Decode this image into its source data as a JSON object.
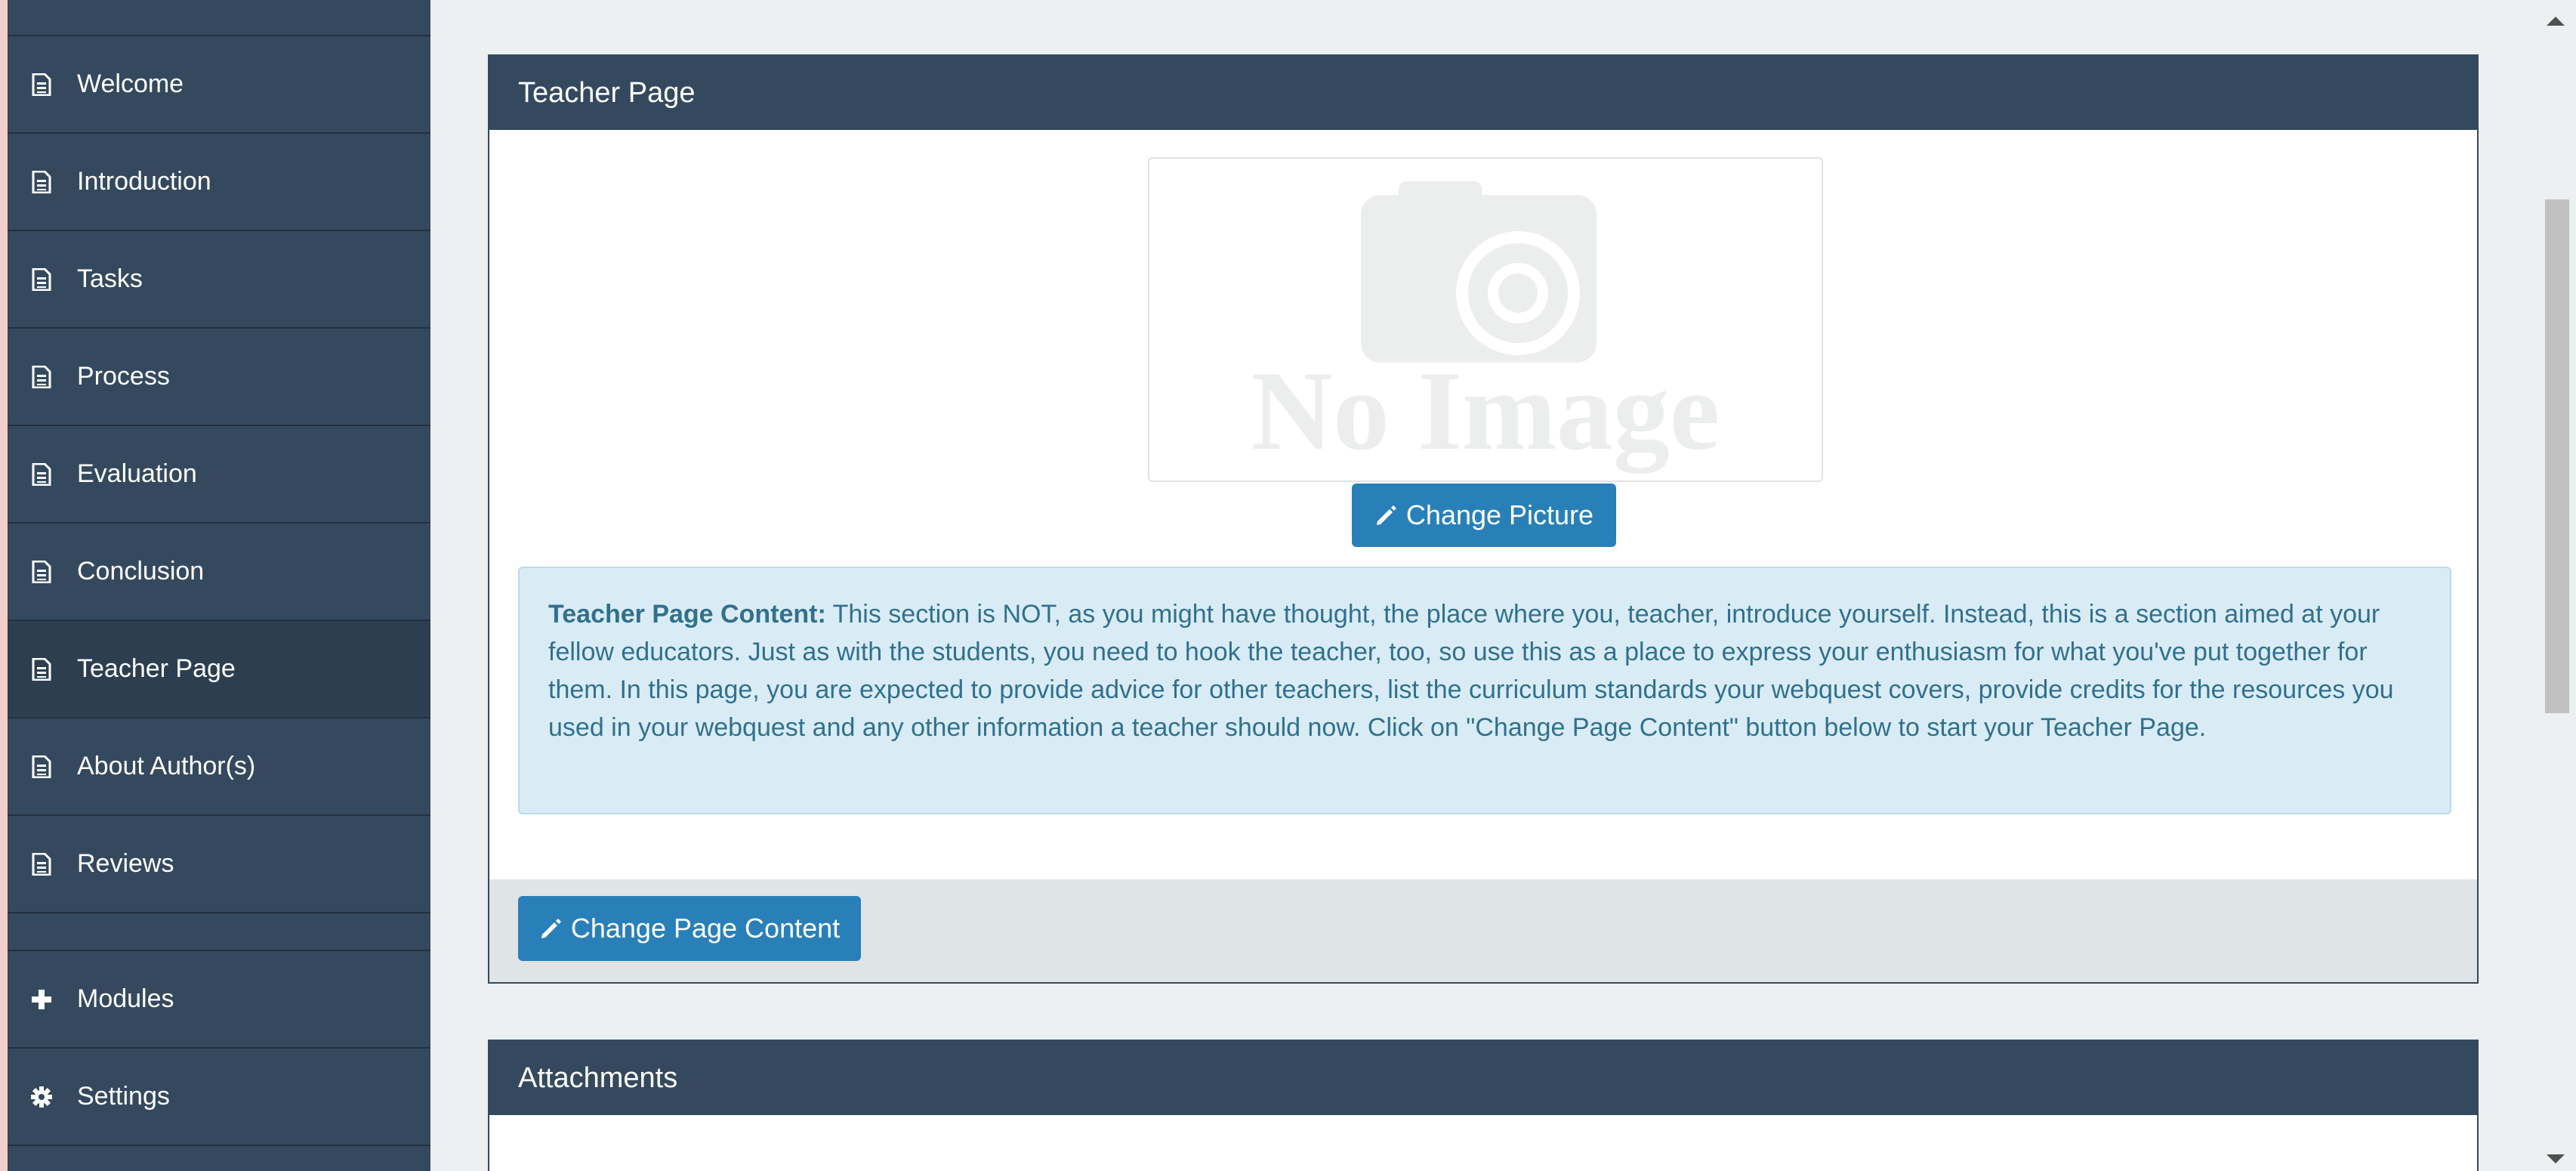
{
  "sidebar": {
    "items": [
      {
        "label": "Welcome",
        "icon": "file-text-icon"
      },
      {
        "label": "Introduction",
        "icon": "file-text-icon"
      },
      {
        "label": "Tasks",
        "icon": "file-text-icon"
      },
      {
        "label": "Process",
        "icon": "file-text-icon"
      },
      {
        "label": "Evaluation",
        "icon": "file-text-icon"
      },
      {
        "label": "Conclusion",
        "icon": "file-text-icon"
      },
      {
        "label": "Teacher Page",
        "icon": "file-text-icon",
        "active": true
      },
      {
        "label": "About Author(s)",
        "icon": "file-text-icon"
      },
      {
        "label": "Reviews",
        "icon": "file-text-icon"
      }
    ],
    "extras": [
      {
        "label": "Modules",
        "icon": "plus-icon"
      },
      {
        "label": "Settings",
        "icon": "gear-icon"
      }
    ]
  },
  "teacher_panel": {
    "title": "Teacher Page",
    "placeholder_image_text": "No Image",
    "change_picture_label": "Change Picture",
    "info_label": "Teacher Page Content:",
    "info_text": " This section is NOT, as you might have thought, the place where you, teacher, introduce yourself. Instead, this is a section aimed at your fellow educators. Just as with the students, you need to hook the teacher, too, so use this as a place to express your enthusiasm for what you've put together for them. In this page, you are expected to provide advice for other teachers, list the curriculum standards your webquest covers, provide credits for the resources you used in your webquest and any other information a teacher should now. Click on \"Change Page Content\" button below to start your Teacher Page.",
    "change_content_label": "Change Page Content"
  },
  "attachments_panel": {
    "title": "Attachments"
  },
  "colors": {
    "sidebar_bg": "#34495e",
    "sidebar_active": "#2c3e50",
    "panel_header": "#34495e",
    "primary_button": "#2980b9",
    "info_bg": "#d9ecf5",
    "info_text": "#31708f",
    "page_bg": "#ecf0f1"
  }
}
